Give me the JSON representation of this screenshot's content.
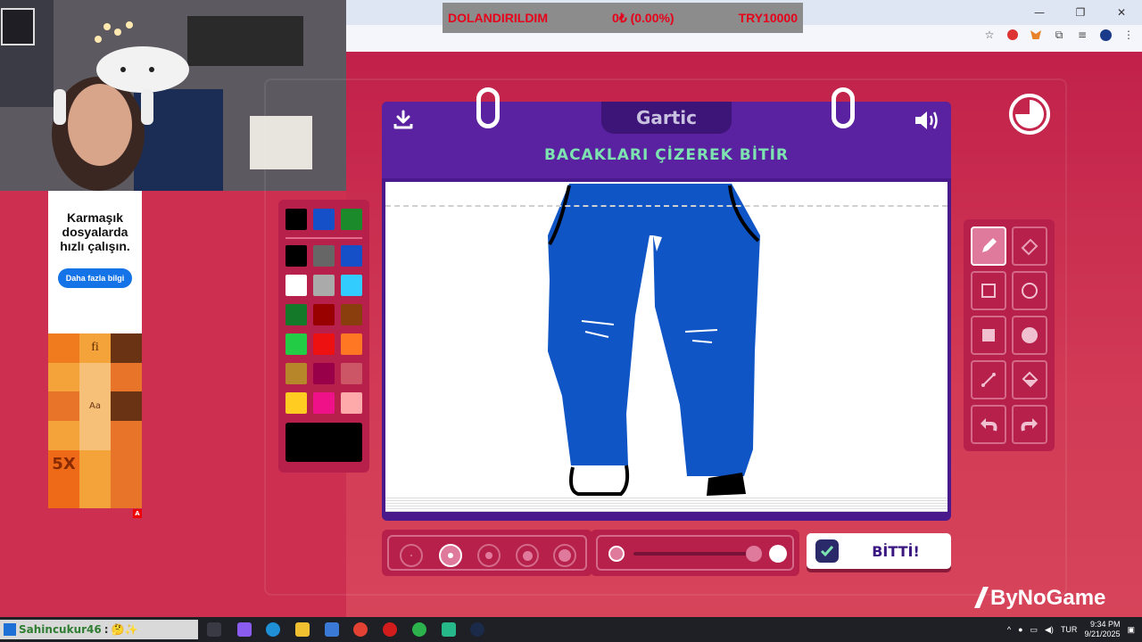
{
  "ticker": {
    "left": "DOLANDIRILDIM",
    "middle": "0₺ (0.00%)",
    "right": "TRY10000"
  },
  "window_controls": [
    "—",
    "❐",
    "✕"
  ],
  "ad": {
    "headline": "Karmaşık dosyalarda hızlı çalışın.",
    "button": "Daha fazla bilgi",
    "badge": "A",
    "art_text": [
      "fi",
      "5X",
      "Aa"
    ]
  },
  "game": {
    "brand_tab": "Gartic",
    "prompt": "BACAKLARI ÇİZEREK BİTİR",
    "done_label": "BİTTİ!",
    "palette_top": [
      "#000000",
      "#1650c8",
      "#1a8a2a"
    ],
    "palette": [
      "#000000",
      "#666666",
      "#1650c8",
      "#ffffff",
      "#aaaaaa",
      "#33ccff",
      "#147a2a",
      "#990000",
      "#8a3e0e",
      "#22cc44",
      "#ee1111",
      "#ff7722",
      "#b8862a",
      "#99004a",
      "#cc5566",
      "#ffcc22",
      "#ee1188",
      "#ffaaaa"
    ],
    "current_color": "#000000",
    "tools": [
      "pencil-icon",
      "eraser-icon",
      "square-outline-icon",
      "circle-outline-icon",
      "square-filled-icon",
      "circle-filled-icon",
      "line-icon",
      "fill-bucket-icon",
      "undo-icon",
      "redo-icon"
    ],
    "active_tool": "pencil-icon"
  },
  "brand": "ByNoGame",
  "taskbar": {
    "chat_user": "Sahincukur46",
    "chat_sep": ":",
    "tray_lang": "TUR",
    "time": "9:34 PM",
    "date": "9/21/2025"
  }
}
